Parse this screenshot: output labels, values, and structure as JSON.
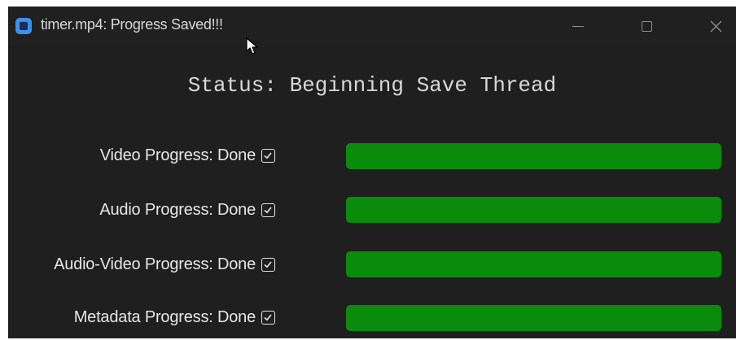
{
  "window": {
    "title": "timer.mp4: Progress Saved!!!"
  },
  "status": {
    "text": "Status: Beginning Save Thread"
  },
  "rows": [
    {
      "label": "Video Progress: Done",
      "progress": 1.0,
      "checked": true
    },
    {
      "label": "Audio Progress: Done",
      "progress": 1.0,
      "checked": true
    },
    {
      "label": "Audio-Video Progress: Done",
      "progress": 1.0,
      "checked": true
    },
    {
      "label": "Metadata Progress: Done",
      "progress": 1.0,
      "checked": true
    }
  ],
  "colors": {
    "progress_fill": "#0b8b0b",
    "window_bg": "#1f1f1f",
    "app_icon": "#3b8ff0"
  },
  "icons": {
    "app": "app-window-icon",
    "minimize": "minimize-icon",
    "maximize": "maximize-icon",
    "close": "close-icon",
    "check": "checkbox-checked-icon",
    "cursor": "mouse-cursor-icon"
  }
}
